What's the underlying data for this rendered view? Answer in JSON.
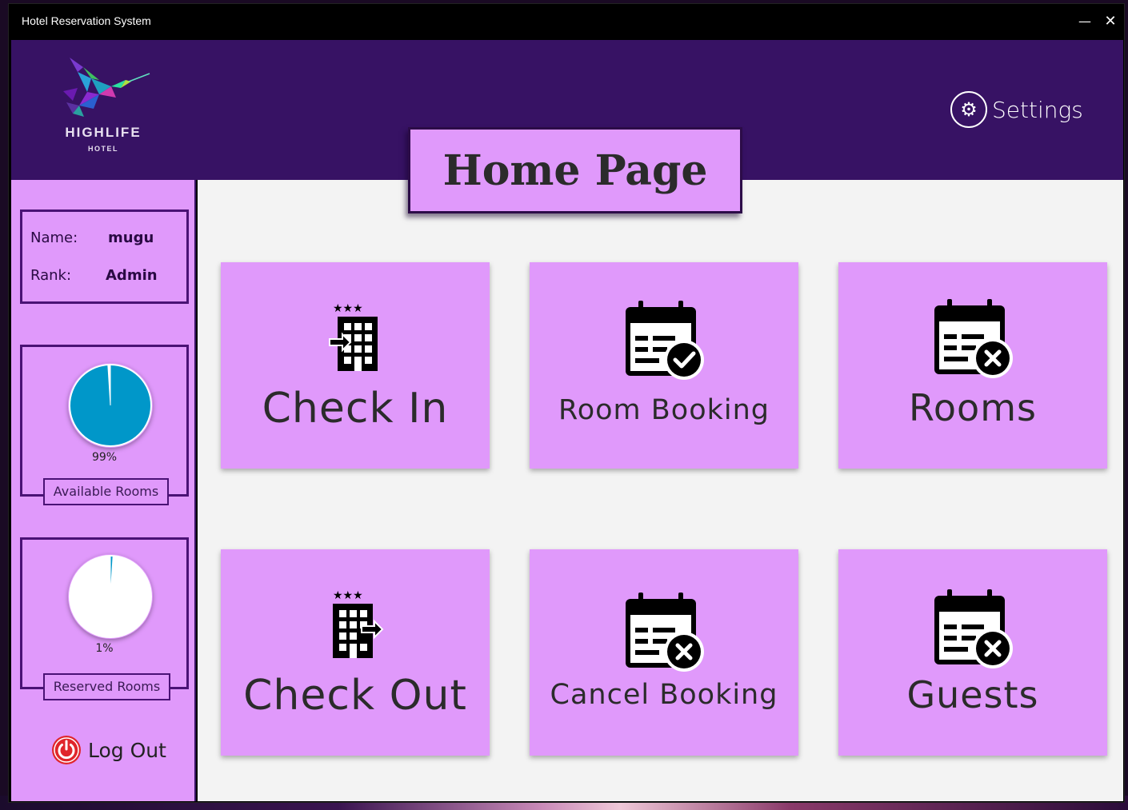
{
  "window": {
    "title": "Hotel Reservation System",
    "minimize_glyph": "—",
    "close_glyph": "✕"
  },
  "logo": {
    "name": "HIGHLIFE",
    "sub": "HOTEL",
    "icon": "hummingbird-logo"
  },
  "header": {
    "settings_label": "Settings",
    "settings_icon": "gear-icon"
  },
  "page_title": "Home Page",
  "user": {
    "name_key": "Name:",
    "name_value": "mugu",
    "rank_key": "Rank:",
    "rank_value": "Admin"
  },
  "stats": {
    "available": {
      "label": "Available Rooms",
      "percent_text": "99%",
      "fraction": 0.99
    },
    "reserved": {
      "label": "Reserved Rooms",
      "percent_text": "1%",
      "fraction": 0.01
    }
  },
  "logout": {
    "label": "Log Out",
    "icon": "power-icon"
  },
  "cards": [
    {
      "label": "Check In",
      "icon": "hotel-check-in-icon"
    },
    {
      "label": "Room Booking",
      "icon": "calendar-check-icon"
    },
    {
      "label": "Rooms",
      "icon": "calendar-x-icon"
    },
    {
      "label": "Check Out",
      "icon": "hotel-check-out-icon"
    },
    {
      "label": "Cancel Booking",
      "icon": "calendar-x-icon"
    },
    {
      "label": "Guests",
      "icon": "calendar-x-icon"
    }
  ],
  "colors": {
    "header": "#371264",
    "card": "#e099fb",
    "sidebar": "#e099fb",
    "main_bg": "#f3f3f3",
    "pie_fill": "#0097c9",
    "logout_red": "#e0262b"
  }
}
